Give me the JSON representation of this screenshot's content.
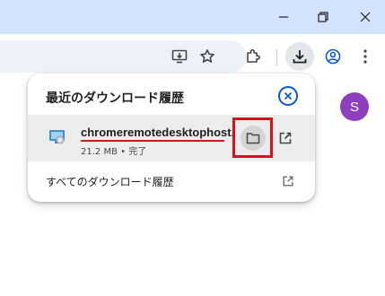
{
  "window": {
    "controls": [
      "minimize-icon",
      "restore-icon",
      "close-icon"
    ]
  },
  "toolbar": {
    "icons": [
      "install-app-icon",
      "bookmark-star-icon",
      "extensions-icon",
      "downloads-icon",
      "profile-icon",
      "more-vert-icon"
    ],
    "active_icon": "downloads-icon"
  },
  "page": {
    "avatar_letter": "S",
    "avatar_color": "#8e3fbf"
  },
  "downloads_bubble": {
    "title": "最近のダウンロード履歴",
    "items": [
      {
        "file_name": "chromeremotedesktophost.msi",
        "status": "21.2 MB • 完了"
      }
    ],
    "all_downloads_label": "すべてのダウンロード履歴"
  },
  "colors": {
    "titlebar": "#d3e3fd",
    "accent": "#0b57d0",
    "highlight": "#d3151b"
  }
}
